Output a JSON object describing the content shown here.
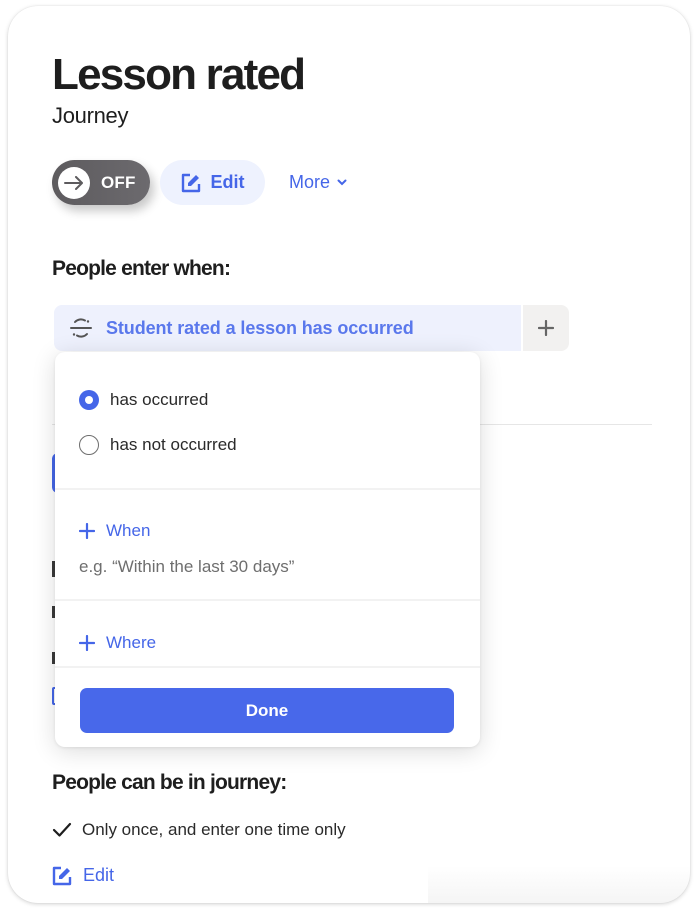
{
  "header": {
    "title": "Lesson rated",
    "subtitle": "Journey"
  },
  "toolbar": {
    "toggle_label": "OFF",
    "toggle_state": "off",
    "edit_label": "Edit",
    "more_label": "More"
  },
  "entry": {
    "heading": "People enter when:",
    "trigger_label": "Student rated a lesson has occurred",
    "trigger_icon": "event-icon",
    "add_icon": "plus-icon"
  },
  "popover": {
    "options": [
      {
        "label": "has occurred",
        "selected": true
      },
      {
        "label": "has not occurred",
        "selected": false
      }
    ],
    "when_label": "When",
    "when_hint": "e.g. “Within the last 30 days”",
    "where_label": "Where",
    "done_label": "Done"
  },
  "frequency": {
    "heading": "People can be in journey:",
    "value": "Only once, and enter one time only",
    "edit_label": "Edit"
  },
  "colors": {
    "accent": "#4566e8",
    "accent_light": "#eef2fe",
    "toggle_bg": "#656367",
    "text": "#1e1e1e"
  }
}
